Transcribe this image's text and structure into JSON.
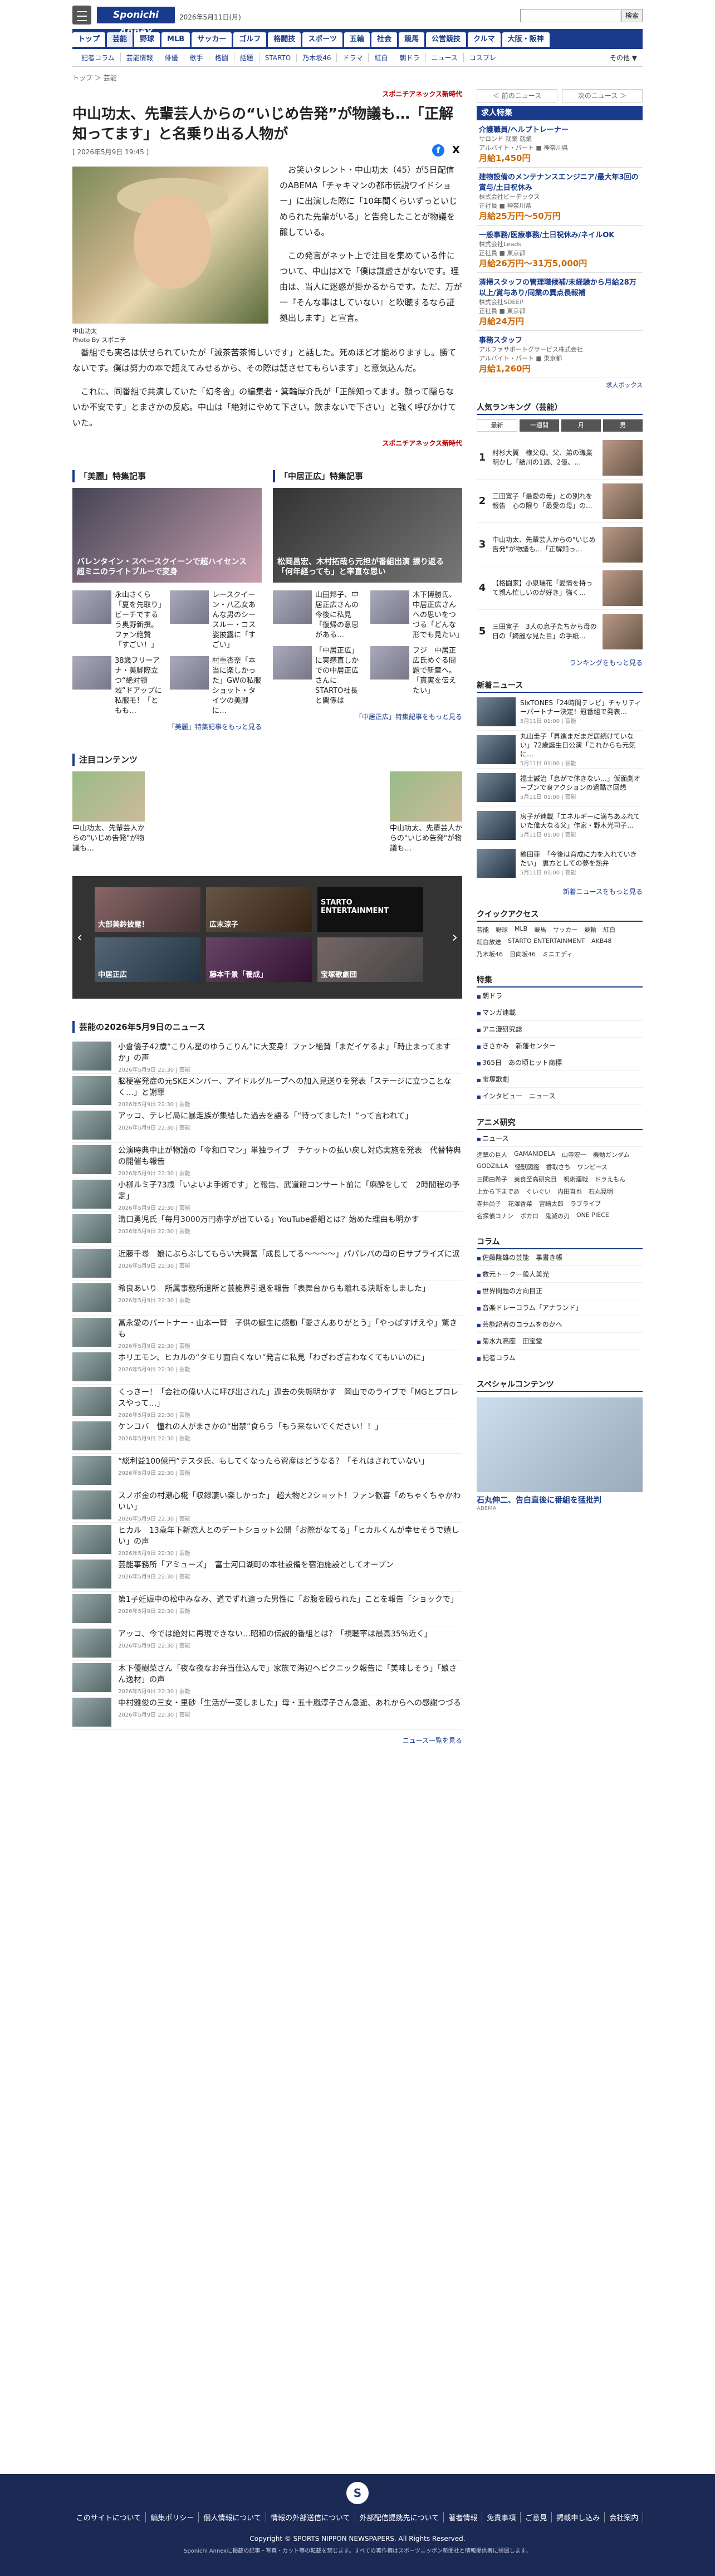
{
  "header": {
    "date": "2026年5月11日(月)",
    "search_btn": "検索",
    "logo": "Sponichi Annex"
  },
  "gnav": [
    "トップ",
    "芸能",
    "野球",
    "MLB",
    "サッカー",
    "ゴルフ",
    "格闘技",
    "スポーツ",
    "五輪",
    "芸能",
    "社会",
    "競馬",
    "公営競技",
    "クルマ",
    "大阪・阪神"
  ],
  "snav": [
    "記者コラム",
    "芸能情報",
    "俳優",
    "歌手",
    "格闘",
    "話題",
    "STARTO",
    "乃木坂46",
    "ドラマ",
    "紅白",
    "朝ドラ",
    "ニュース",
    "コスプレ"
  ],
  "snav_more": "その他 ▼",
  "breadcrumb": "トップ ＞ 芸能",
  "nav": {
    "prev": "＜ 前のニュース",
    "next": "次のニュース ＞"
  },
  "article": {
    "source": "スポニチアネックス新時代",
    "title": "中山功太、先輩芸人からの“いじめ告発”が物議も…「正解知ってます」と名乗り出る人物が",
    "date": "[ 2026年5月9日 19:45 ]",
    "caption1": "中山功太",
    "caption2": "Photo By スポニチ",
    "p1": "お笑いタレント・中山功太（45）が5日配信のABEMA「チャキマンの都市伝説ワイドショー」に出演した際に「10年間くらいずっといじめられた先輩がいる」と告発したことが物議を醸している。",
    "p2": "この発言がネット上で注目を集めている件について、中山はXで「僕は謙虚さがないです。理由は、当人に迷惑が掛かるからです。ただ、万が一『そんな事はしていない』と吹聴するなら証拠出します」と宣言。",
    "p3": "番組でも実名は伏せられていたが「滅茶苦茶悔しいです」と話した。死ぬほど才能ありますし。勝てないです。僕は努力の本で超えてみせるから、その際は話させてもらいます」と意気込んだ。",
    "p4": "これに、同番組で共演していた「幻冬舎」の編集者・箕輪厚介氏が「正解知ってます。顔って隠らないか不安です」とまさかの反応。中山は「絶対にやめて下さい。飲まないで下さい」と強く呼びかけていた。",
    "footer_src": "スポニチアネックス新時代"
  },
  "feature1": {
    "title": "「美麗」特集記事",
    "more": "「美麗」特集記事をもっと見る",
    "big": "バレンタイン・スペースクイーンで超ハイセンス 超ミニのライトブルーで変身",
    "items": [
      "永山さくら「夏を先取り」ビーチでするう奥野新撰。ファン絶賛「すごい！」",
      "レースクイーン・八乙女あんな男のシースルー・コス姿披露に「すごい」",
      "38歳フリーアナ・美脚際立つ“絶対領域”ドアップに私服モ！「ともも…",
      "村重杏奈「本当に楽しかった」GWの私服ショット・タイツの美脚に…"
    ]
  },
  "feature2": {
    "title": "「中居正広」特集記事",
    "more": "「中居正広」特集記事をもっと見る",
    "big": "松岡昌宏、木村拓哉ら元担が番組出演 振り返る「何年経っても」と率直な思い",
    "items": [
      "山田邦子、中居正広さんの今後に私見「復帰の意思がある…",
      "木下博勝氏、中居正広さんへの思いをつづる「どんな形でも見たい」",
      "「中居正広」に実感直しかでの中居正広さんにSTARTO社長と関係は",
      "フジ　中居正広氏めぐる問題で新章へ。「真実を伝えたい」"
    ]
  },
  "attention": {
    "title": "注目コンテンツ",
    "items": [
      "中山功太、先輩芸人からの\"いじめ告発\"が物議も…",
      "中山功太、先輩芸人からの\"いじめ告発\"が物議も…"
    ]
  },
  "carousel": [
    "大部美鈴披露！",
    "広末涼子",
    "STARTO ENTERTAINMENT",
    "中居正広",
    "藤本千景「養成」",
    "宝塚歌劇団"
  ],
  "news": {
    "title": "芸能の2026年5月9日のニュース",
    "more": "ニュース一覧を見る",
    "items": [
      "小倉優子42歳“こりん星のゆうこりん”に大変身！ファン絶賛「まだイケるよ」「時止まってますか」の声",
      "脳梗塞発症の元SKEメンバー、アイドルグループへの加入見送りを発表「ステージに立つことなく…」と謝罪",
      "アッコ、テレビ局に暴走族が集結した過去を語る「“待ってました！”って言われて」",
      "公演時典中止が物議の「令和ロマン」単独ライブ　チケットの払い戻し対応実施を発表　代替特典の開催も報告",
      "小柳ルミ子73歳「いよいよ手術です」と報告、武道館コンサート前に「麻酔をして　2時間程の予定」",
      "溝口勇児氏「毎月3000万円赤字が出ている」YouTube番組とは？始めた理由も明かす",
      "近藤千尋　娘にぶらぶしてもらい大興奮「成長してる～～～～」パパレパの母の日サプライズに涙",
      "希良あいり　所属事務所退所と芸能界引退を報告「表舞台からも離れる決断をしました」",
      "冨永愛のパートナー・山本一賢　子供の誕生に感動「愛さんありがとう」「やっぱすげえや」驚きも",
      "ホリエモン、ヒカルの“タモリ面白くない”発言に私見「わざわざ言わなくてもいいのに」",
      "くっきー！「会社の偉い人に呼び出された」過去の失態明かす　岡山でのライブで「MGとプロレスやって…」",
      "ケンコバ　憧れの人がまさかの“出禁”食らう「もう来ないでください！！」",
      "“総利益100億円”テスタ氏、もしてくなったら資産はどうなる？「それはされていない」",
      "スノボ金の村瀬心椛「収録凄い楽しかった」 超大物と2ショット！ファン歓喜「めちゃくちゃかわいい」",
      "ヒカル　13歳年下新恋人とのデートショット公開「お際がなてる」「ヒカルくんが幸せそうで嬉しい」の声",
      "芸能事務所「アミューズ」　富士河口湖町の本社設備を宿泊施設としてオープン",
      "第1子妊娠中の松中みなみ、道でずれ違った男性に「お腹を殴られた」ことを報告「ショックで」",
      "アッコ、今では絶対に再現できない…昭和の伝説的番組とは？「視聴率は最高35％近く」",
      "木下優樹菜さん「夜な夜なお弁当仕込んで」家族で海辺ヘピクニック報告に「美味しそう」「娘さん逸材」の声",
      "中村雅俊の三女・里砂「生活が一変しました」母・五十嵐淳子さん急逝、あれからへの感謝つづる"
    ],
    "dates": "2026年5月9日 22:30 | 芸能"
  },
  "jobs": {
    "title": "求人特集",
    "items": [
      {
        "a": "介護職員/ヘルプトレーナー",
        "b": "サロンド 就業 就業",
        "c": "アルバイト・パート ■ 神奈川県",
        "d": "月給1,450円"
      },
      {
        "a": "建物設備のメンテナンスエンジニア/最大年3回の賞与/土日祝休み",
        "b": "株式会社ビーテックス",
        "c": "正社員 ■ 神奈川県",
        "d": "月給25万円～50万円"
      },
      {
        "a": "一般事務/医療事務/土日祝休み/ネイルOK",
        "b": "株式会社Leads",
        "c": "正社員 ■ 東京都",
        "d": "月給26万円～31万5,000円"
      },
      {
        "a": "清掃スタッフの管理職候補/未経験から月給28万以上/賞与あり/同業の異点長報補",
        "b": "株式会社SDEEP",
        "c": "正社員 ■ 東京都",
        "d": "月給24万円"
      },
      {
        "a": "事務スタッフ",
        "b": "アルファサポートグサービス株式会社",
        "c": "アルバイト・パート ■ 東京都",
        "d": "月給1,260円"
      }
    ],
    "brand": "求人ボックス"
  },
  "ranking": {
    "title": "人気ランキング（芸能）",
    "tabs": [
      "最新",
      "一週間",
      "月",
      "男"
    ],
    "more": "ランキングをもっと見る",
    "items": [
      "村杉大翼　様父母、父、弟の職業明かし「結川の1週、2億、…",
      "三田寛子「最愛の母」との別れを報告　心の限り「最愛の母」の...",
      "中山功太、先輩芸人からの\"いじめ告発\"が物議も…「正解知っ…",
      "【格闘家】小泉瑞花「愛情を持って親ん忙しいのが好き」強く…",
      "三田寛子　3人の息子たちから母の日の「綺麗な見た目」の手紙..."
    ]
  },
  "snews": {
    "title": "新着ニュース",
    "more": "新着ニュースをもっと見る",
    "items": [
      "SixTONES「24時間テレビ」チャリティーパートナー決定！冠番組で発表…",
      "丸山圭子「昇進まだまだ居続けていない」72歳誕生日公演「これからも元気に…",
      "福士誠治「息がで体きない…」仮面劇オープンで身アクションの過酷さ回想",
      "房子が連載「エネルギーに満ちあふれていた偉大なる父」作家・野木光司子…",
      "鶴田亜　「今後は育成に力を入れていきたい」 裏方としての夢を熱弁"
    ],
    "date": "5月11日 01:00 | 芸能"
  },
  "quick": {
    "title": "クイックアクセス",
    "items": [
      "芸能",
      "野球",
      "MLB",
      "競馬",
      "サッカー",
      "競輪",
      "紅白",
      "紅白放送",
      "STARTO ENTERTAINMENT",
      "AKB48",
      "乃木坂46",
      "日向坂46",
      "ミニエディ"
    ]
  },
  "special": {
    "title": "特集",
    "items": [
      "朝ドラ",
      "マンガ連載",
      "アニ漫研究誌",
      "きさかみ　新藩センター",
      "365日　あの頃ヒット商標",
      "宝塚歌劇",
      "インタビュー　ニュース"
    ]
  },
  "anime": {
    "title": "アニメ研究",
    "items": [
      "ニュース"
    ],
    "tags": [
      "進撃の巨人",
      "GAMANIDELA",
      "山寺宏一",
      "機動ガンダム",
      "GODZILLA",
      "怪獣図鑑",
      "香取さち",
      "ワンピース",
      "三間由希子",
      "美食至高研究目",
      "呪術廻戦",
      "ドラえもん",
      "上から下まであ",
      "ぐいぐい",
      "内田直也",
      "石丸晃明",
      "寺井尚子",
      "花澤香菜",
      "宮崎太郎",
      "ラブライブ",
      "名探偵コナン",
      "ボカロ",
      "鬼滅の刃",
      "ONE PIECE"
    ]
  },
  "column": {
    "title": "コラム",
    "items": [
      "佐藤隆雄の芸能　事書き帳",
      "数元トーク一般人美光",
      "世界問題の方向目正",
      "音楽ドレーコラム「アナランド」",
      "芸能記者のコラムをのかへ",
      "菊水丸高座　田宝堂",
      "記者コラム"
    ]
  },
  "sp": {
    "title": "スペシャルコンテンツ",
    "caption": "石丸伸二、告白直後に番組を猛批判",
    "sub": "ABEMA"
  },
  "footer": {
    "links": [
      "このサイトについて",
      "編集ポリシー",
      "個人情報について",
      "情報の外部送信について",
      "外部配信提携先について",
      "著者情報",
      "免責事項",
      "ご意見",
      "掲載申し込み",
      "会社案内"
    ],
    "copyright": "Copyright © SPORTS NIPPON NEWSPAPERS. All Rights Reserved.",
    "note": "Sponichi Annexに掲載の記事・写真・カット等の転載を禁じます。すべての著作権はスポーツニッポン新聞社と情報提供者に帰属します。"
  }
}
